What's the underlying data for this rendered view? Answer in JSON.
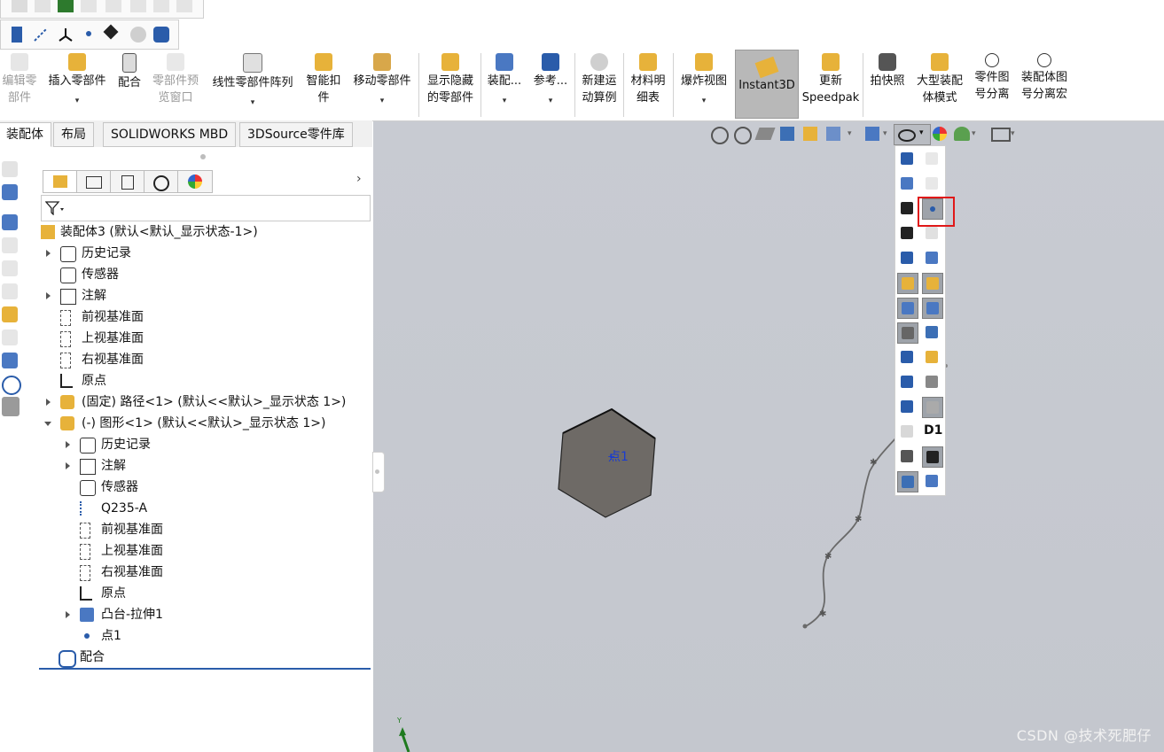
{
  "command_manager": {
    "edit_part": [
      "编辑零",
      "部件"
    ],
    "insert_component": [
      "插入零部件"
    ],
    "mate": [
      "配合"
    ],
    "component_preview": [
      "零部件预",
      "览窗口"
    ],
    "linear_pattern": [
      "线性零部件阵列"
    ],
    "smart_fasteners": [
      "智能扣",
      "件"
    ],
    "move_component": [
      "移动零部件"
    ],
    "show_hidden": [
      "显示隐藏",
      "的零部件"
    ],
    "assembly": [
      "装配..."
    ],
    "reference": [
      "参考..."
    ],
    "new_motion": [
      "新建运",
      "动算例"
    ],
    "bom": [
      "材料明",
      "细表"
    ],
    "exploded_view": [
      "爆炸视图"
    ],
    "instant3d": "Instant3D",
    "update_speedpak": [
      "更新",
      "Speedpak"
    ],
    "snapshot": [
      "拍快照"
    ],
    "large_assembly": [
      "大型装配",
      "体模式"
    ],
    "part_drawing_separate": [
      "零件图",
      "号分离"
    ],
    "assembly_drawing_separate": [
      "装配体图",
      "号分离宏"
    ]
  },
  "tabs": [
    "装配体",
    "布局",
    "SOLIDWORKS MBD",
    "3DSource零件库"
  ],
  "tree": {
    "root": "装配体3 (默认<默认_显示状态-1>)",
    "items": [
      {
        "label": "历史记录",
        "icon": "history-icon"
      },
      {
        "label": "传感器",
        "icon": "sensor-icon"
      },
      {
        "label": "注解",
        "icon": "annotation-icon"
      },
      {
        "label": "前视基准面",
        "icon": "plane-icon"
      },
      {
        "label": "上视基准面",
        "icon": "plane-icon"
      },
      {
        "label": "右视基准面",
        "icon": "plane-icon"
      },
      {
        "label": "原点",
        "icon": "origin-icon"
      },
      {
        "label": "(固定) 路径<1> (默认<<默认>_显示状态 1>)",
        "icon": "part-icon"
      },
      {
        "label": "(-) 图形<1> (默认<<默认>_显示状态 1>)",
        "icon": "part-icon"
      },
      {
        "label": "历史记录",
        "icon": "history-icon"
      },
      {
        "label": "注解",
        "icon": "annotation-icon"
      },
      {
        "label": "传感器",
        "icon": "sensor-icon"
      },
      {
        "label": "Q235-A",
        "icon": "material-icon"
      },
      {
        "label": "前视基准面",
        "icon": "plane-icon"
      },
      {
        "label": "上视基准面",
        "icon": "plane-icon"
      },
      {
        "label": "右视基准面",
        "icon": "plane-icon"
      },
      {
        "label": "原点",
        "icon": "origin-icon"
      },
      {
        "label": "凸台-拉伸1",
        "icon": "extrude-icon"
      },
      {
        "label": "点1",
        "icon": "point-icon"
      },
      {
        "label": "配合",
        "icon": "mates-icon"
      }
    ]
  },
  "viewport": {
    "point_label": "点1",
    "triad_y": "Y"
  },
  "flyout": {
    "d1_label": "D1"
  },
  "watermark": "CSDN @技术死肥仔",
  "colors": {
    "highlight": "#e01818",
    "viewport_bg": "#c6c9d0",
    "hexagon": "#6e6a66",
    "accent_blue": "#2a5caa"
  }
}
